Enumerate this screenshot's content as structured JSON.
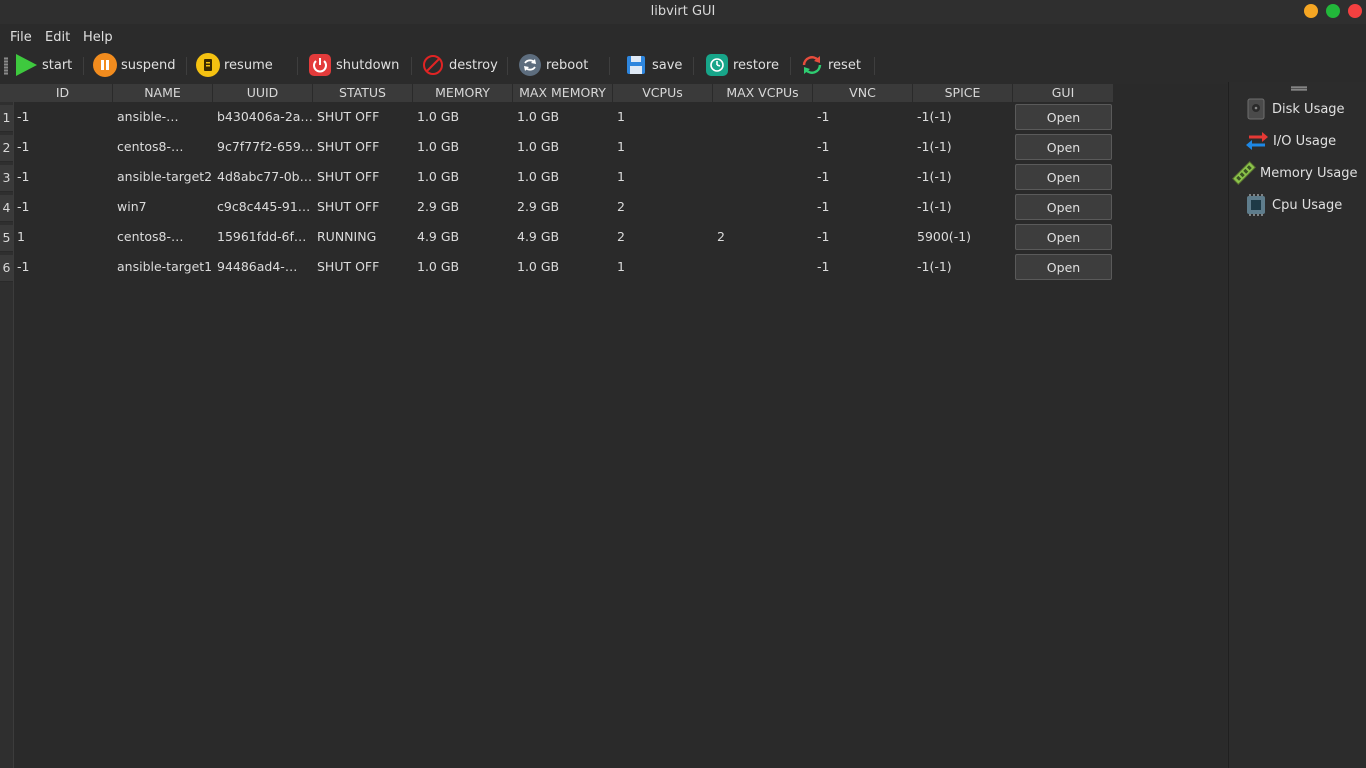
{
  "window": {
    "title": "libvirt GUI"
  },
  "menu": [
    "File",
    "Edit",
    "Help"
  ],
  "toolbar": {
    "start": "start",
    "suspend": "suspend",
    "resume": "resume",
    "shutdown": "shutdown",
    "destroy": "destroy",
    "reboot": "reboot",
    "save": "save",
    "restore": "restore",
    "reset": "reset"
  },
  "table": {
    "columns": [
      "ID",
      "NAME",
      "UUID",
      "STATUS",
      "MEMORY",
      "MAX MEMORY",
      "VCPUs",
      "MAX VCPUs",
      "VNC",
      "SPICE",
      "GUI"
    ],
    "rows": [
      {
        "num": "1",
        "id": "-1",
        "name": "ansible-…",
        "uuid": "b430406a-2a…",
        "status": "SHUT OFF",
        "memory": "1.0 GB",
        "max_memory": "1.0 GB",
        "vcpus": "1",
        "max_vcpus": "",
        "vnc": "-1",
        "spice": "-1(-1)",
        "gui": "Open"
      },
      {
        "num": "2",
        "id": "-1",
        "name": "centos8-…",
        "uuid": "9c7f77f2-659…",
        "status": "SHUT OFF",
        "memory": "1.0 GB",
        "max_memory": "1.0 GB",
        "vcpus": "1",
        "max_vcpus": "",
        "vnc": "-1",
        "spice": "-1(-1)",
        "gui": "Open"
      },
      {
        "num": "3",
        "id": "-1",
        "name": "ansible-target2",
        "uuid": "4d8abc77-0b…",
        "status": "SHUT OFF",
        "memory": "1.0 GB",
        "max_memory": "1.0 GB",
        "vcpus": "1",
        "max_vcpus": "",
        "vnc": "-1",
        "spice": "-1(-1)",
        "gui": "Open"
      },
      {
        "num": "4",
        "id": "-1",
        "name": "win7",
        "uuid": "c9c8c445-91…",
        "status": "SHUT OFF",
        "memory": "2.9 GB",
        "max_memory": "2.9 GB",
        "vcpus": "2",
        "max_vcpus": "",
        "vnc": "-1",
        "spice": "-1(-1)",
        "gui": "Open"
      },
      {
        "num": "5",
        "id": "1",
        "name": "centos8-…",
        "uuid": "15961fdd-6f…",
        "status": "RUNNING",
        "memory": "4.9 GB",
        "max_memory": "4.9 GB",
        "vcpus": "2",
        "max_vcpus": "2",
        "vnc": "-1",
        "spice": "5900(-1)",
        "gui": "Open"
      },
      {
        "num": "6",
        "id": "-1",
        "name": "ansible-target1",
        "uuid": "94486ad4-…",
        "status": "SHUT OFF",
        "memory": "1.0 GB",
        "max_memory": "1.0 GB",
        "vcpus": "1",
        "max_vcpus": "",
        "vnc": "-1",
        "spice": "-1(-1)",
        "gui": "Open"
      }
    ]
  },
  "sidebar": {
    "items": [
      "Disk Usage",
      "I/O Usage",
      "Memory Usage",
      "Cpu Usage"
    ]
  },
  "colors": {
    "close": "#f44040",
    "maximize": "#22b83a",
    "minimize": "#f5a623"
  }
}
